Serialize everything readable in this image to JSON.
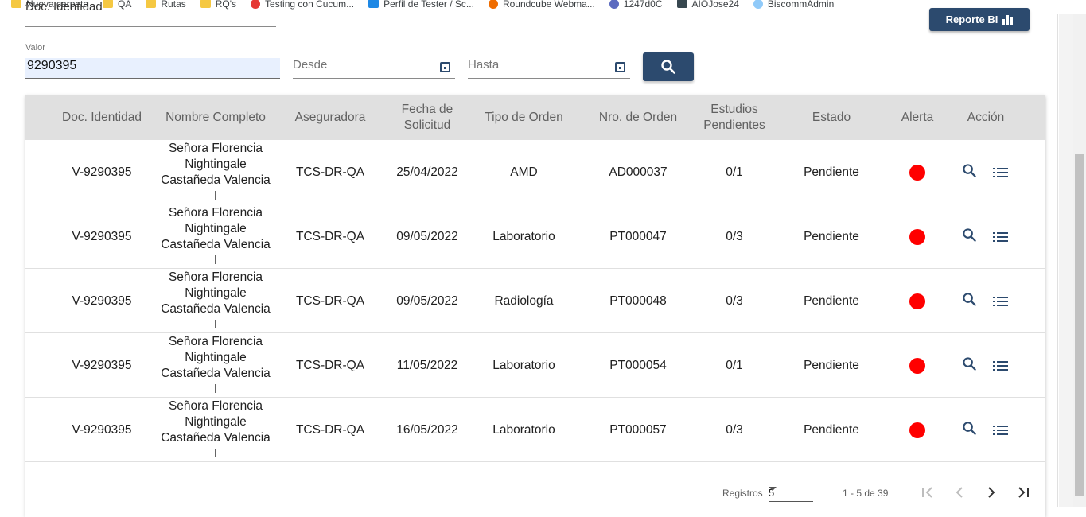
{
  "bookmarks": [
    "Nueva carpeta",
    "QA",
    "Rutas",
    "RQ's",
    "Testing con Cucum...",
    "Perfil de Tester / Sc...",
    "Roundcube Webma...",
    "1247d0C",
    "AIOJose24",
    "BiscommAdmin"
  ],
  "filters": {
    "doc_type": "Doc. Identidad",
    "valor_label": "Valor",
    "valor_value": "9290395",
    "desde_placeholder": "Desde",
    "hasta_placeholder": "Hasta"
  },
  "report_button_label": "Reporte BI",
  "table": {
    "headers": {
      "doc": "Doc. Identidad",
      "nombre": "Nombre Completo",
      "aseg": "Aseguradora",
      "fecha": "Fecha de Solicitud",
      "tipo": "Tipo de Orden",
      "nro": "Nro. de Orden",
      "estudios": "Estudios Pendientes",
      "estado": "Estado",
      "alerta": "Alerta",
      "accion": "Acción"
    },
    "rows": [
      {
        "doc": "V-9290395",
        "nombre": "Señora Florencia Nightingale Castañeda Valencia I",
        "aseg": "TCS-DR-QA",
        "fecha": "25/04/2022",
        "tipo": "AMD",
        "nro": "AD000037",
        "estudios": "0/1",
        "estado": "Pendiente"
      },
      {
        "doc": "V-9290395",
        "nombre": "Señora Florencia Nightingale Castañeda Valencia I",
        "aseg": "TCS-DR-QA",
        "fecha": "09/05/2022",
        "tipo": "Laboratorio",
        "nro": "PT000047",
        "estudios": "0/3",
        "estado": "Pendiente"
      },
      {
        "doc": "V-9290395",
        "nombre": "Señora Florencia Nightingale Castañeda Valencia I",
        "aseg": "TCS-DR-QA",
        "fecha": "09/05/2022",
        "tipo": "Radiología",
        "nro": "PT000048",
        "estudios": "0/3",
        "estado": "Pendiente"
      },
      {
        "doc": "V-9290395",
        "nombre": "Señora Florencia Nightingale Castañeda Valencia I",
        "aseg": "TCS-DR-QA",
        "fecha": "11/05/2022",
        "tipo": "Laboratorio",
        "nro": "PT000054",
        "estudios": "0/1",
        "estado": "Pendiente"
      },
      {
        "doc": "V-9290395",
        "nombre": "Señora Florencia Nightingale Castañeda Valencia I",
        "aseg": "TCS-DR-QA",
        "fecha": "16/05/2022",
        "tipo": "Laboratorio",
        "nro": "PT000057",
        "estudios": "0/3",
        "estado": "Pendiente"
      }
    ]
  },
  "pagination": {
    "registros_label": "Registros",
    "page_size": "5",
    "range": "1 - 5 de 39"
  },
  "colors": {
    "primary": "#2c4a6e",
    "alert": "#ff0000",
    "header_bg": "#e0e0e0"
  }
}
